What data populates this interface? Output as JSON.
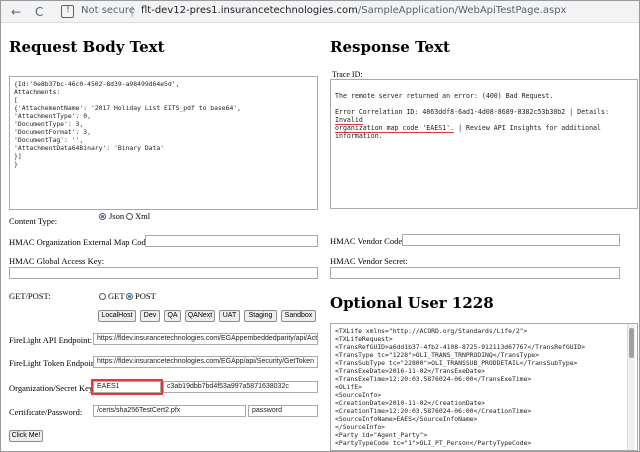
{
  "browser": {
    "back_glyph": "←",
    "reload_glyph": "C",
    "security_label": "Not secure",
    "separator": "|",
    "url_host": "flt-dev12-pres1.insurancetechnologies.com",
    "url_path": "/SampleApplication/WebApiTestPage.aspx"
  },
  "request": {
    "title": "Request Body Text",
    "body_lines": [
      "{Id:'0e8b37bc-46c0-4502-8d39-a98499d64e5d',",
      "Attachments:",
      "[",
      "{'AttachementName': '2017 Holiday List EITS_pdf to base64',",
      "'AttachmentType': 0,",
      "'DocumentType': 3,",
      "'DocumentFormat': 3,",
      "'DocumentTag': '',",
      "'AttachmentData64Binary': 'Binary Data'",
      "}]",
      "}"
    ]
  },
  "response": {
    "title": "Response Text",
    "trace_label": "Trace ID:",
    "error_line1": "The remote server returned an error: (400) Bad Request.",
    "error_line2a": "Error Correlation ID: 4863ddf8-6ad1-4d08-8689-8382c53b30b2 | Details: ",
    "error_highlight1": "Invalid",
    "error_highlight2": "organization map code 'EAES1'.",
    "error_line3b": " | Review API Insights for additional information."
  },
  "form": {
    "content_type_label": "Content Type:",
    "content_type_options": [
      "Json",
      "Xml"
    ],
    "hmac_org_ext_label": "HMAC Organization External Map Code:",
    "hmac_vendor_code_label": "HMAC Vendor Code:",
    "hmac_global_key_label": "HMAC Global Access Key:",
    "hmac_vendor_secret_label": "HMAC Vendor Secret:",
    "method_label": "GET/POST:",
    "method_options": [
      "GET",
      "POST"
    ],
    "env_buttons": [
      "LocalHost",
      "Dev",
      "QA",
      "QANext",
      "UAT",
      "Staging",
      "Sandbox"
    ],
    "api_endpoint_label": "FireLight API Endpoint:",
    "api_endpoint_value": "https://fldev.insurancetechnologies.com/EGAppembeddedparity/api/Activity/Upl",
    "token_endpoint_label": "FireLight Token Endpoint:",
    "token_endpoint_value": "https://fldev.insurancetechnologies.com/EGApp/api/Security/GetToken",
    "org_key_label": "Organization/Secret Key:",
    "org_value": "EAES1",
    "secret_value": "c3ab19dbb7bd4f53a997a5871638032c",
    "cert_label": "Certificate/Password:",
    "cert_value": "/certs/sha256TestCert2.pfx",
    "password_value": "password",
    "submit_label": "Click Me!"
  },
  "optional": {
    "title": "Optional User 1228",
    "xml_lines": [
      "<TXLife xmlns=\"http://ACORD.org/Standards/Life/2\">",
      "<TXLifeRequest>",
      "<TransRefGUID>a6dd1b37-4fb2-4108-8725-912113d67767</TransRefGUID>",
      "<TransType tc=\"1228\">OLI_TRANS_TRNPRODINQ</TransType>",
      "<TransSubType tc=\"22800\">OLI_TRANSSUB_PRODDETAIL</TransSubType>",
      "<TransExeDate>2016-11-02</TransExeDate>",
      "<TransExeTime>12:20:03.5876024-06:00</TransExeTime>",
      "<OLifE>",
      "<SourceInfo>",
      "<CreationDate>2010-11-02</CreationDate>",
      "<CreationTime>12:20:03.5876024-06:00</CreationTime>",
      "<SourceInfoName>EAES</SourceInfoName>",
      "</SourceInfo>",
      "<Party id=\"Agent_Party\">",
      "<PartyTypeCode tc=\"1\">OLI_PT_Person</PartyTypeCode>"
    ]
  },
  "colors": {
    "highlight": "#e53935",
    "radio_accent": "#1a73e8"
  }
}
